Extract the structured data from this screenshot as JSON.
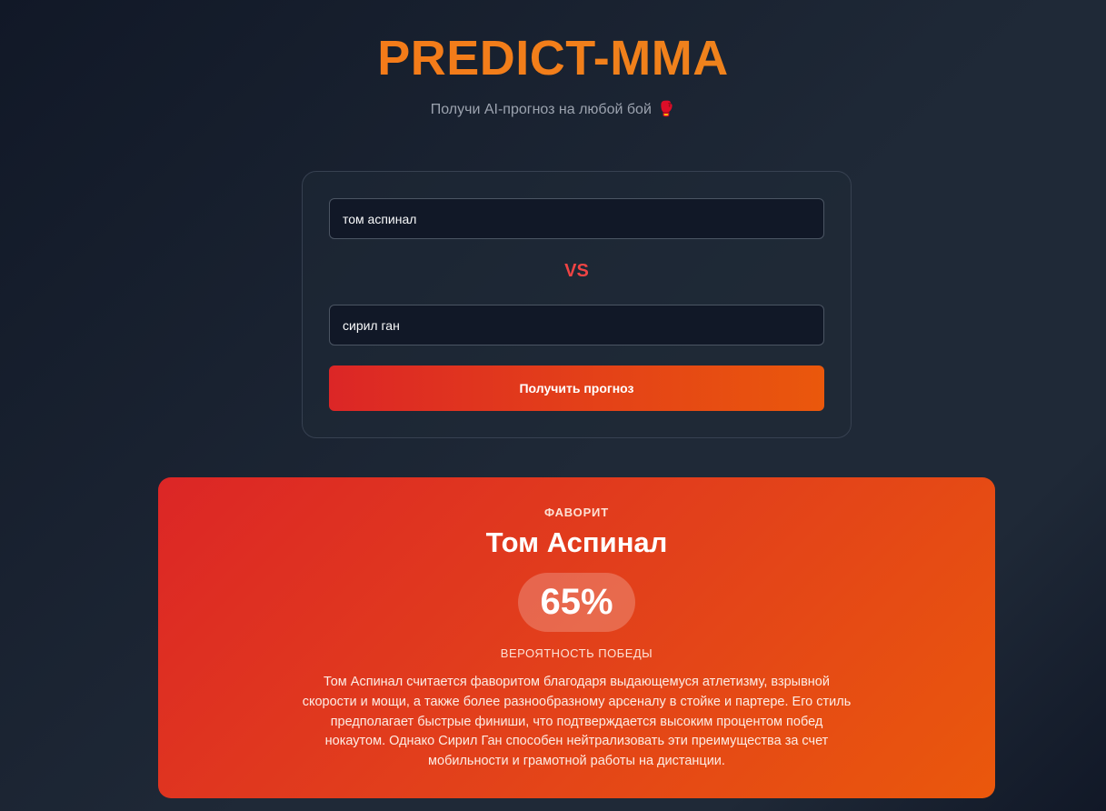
{
  "header": {
    "title": "PREDICT-MMA",
    "subtitle": "Получи AI-прогноз на любой бой",
    "subtitle_emoji": "🥊"
  },
  "form": {
    "fighter1_value": "том аспинал",
    "fighter2_value": "сирил ган",
    "vs_label": "VS",
    "submit_label": "Получить прогноз"
  },
  "result": {
    "favorite_label": "ФАВОРИТ",
    "favorite_name": "Том Аспинал",
    "win_probability": "65%",
    "probability_label": "ВЕРОЯТНОСТЬ ПОБЕДЫ",
    "explanation": "Том Аспинал считается фаворитом благодаря выдающемуся атлетизму, взрывной скорости и мощи, а также более разнообразному арсеналу в стойке и партере. Его стиль предполагает быстрые финиши, что подтверждается высоким процентом побед нокаутом. Однако Сирил Ган способен нейтрализовать эти преимущества за счет мобильности и грамотной работы на дистанции."
  },
  "colors": {
    "accent_orange": "#f97316",
    "vs_red": "#ef4444",
    "button_gradient_start": "#dc2626",
    "button_gradient_end": "#ea580c"
  }
}
